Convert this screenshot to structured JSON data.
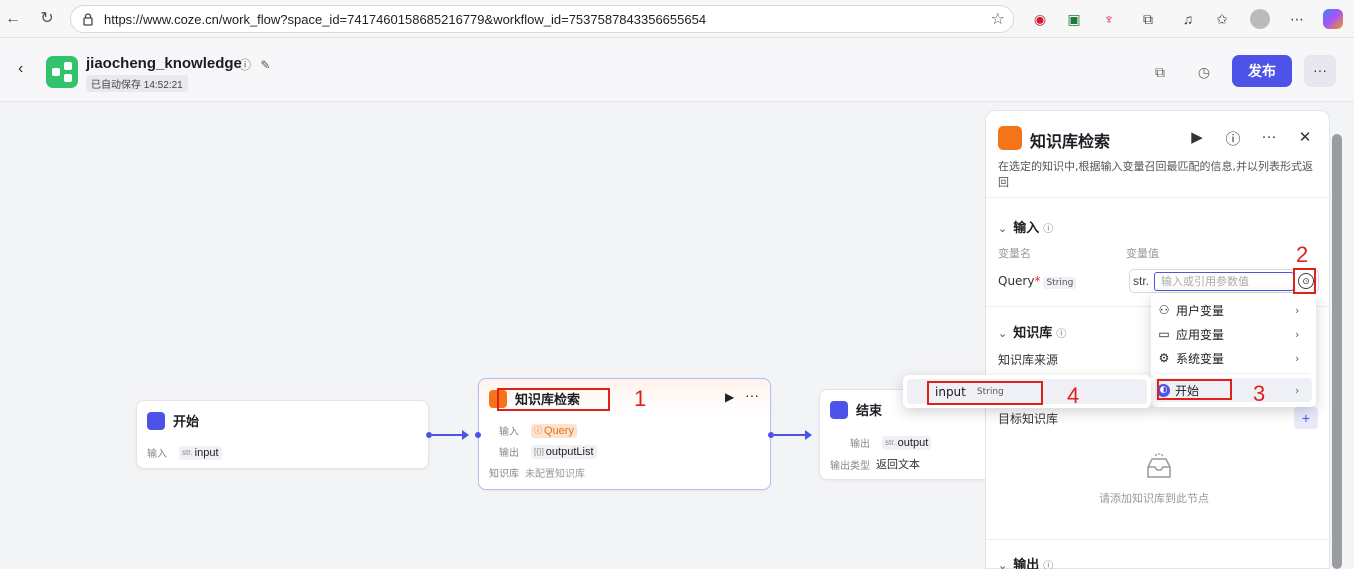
{
  "browser": {
    "url": "https://www.coze.cn/work_flow?space_id=7417460158685216779&workflow_id=7537587843356655654"
  },
  "header": {
    "title": "jiaocheng_knowledge",
    "saved_status": "已自动保存 14:52:21",
    "publish_label": "发布",
    "more_label": "···"
  },
  "nodes": {
    "start": {
      "title": "开始",
      "rows": [
        {
          "label": "输入",
          "type": "str.",
          "value": "input"
        }
      ]
    },
    "knowledge": {
      "title": "知识库检索",
      "input_label": "输入",
      "input_value": "Query",
      "output_label": "输出",
      "output_type": "[{}]",
      "output_value": "outputList",
      "kb_label": "知识库",
      "kb_value": "未配置知识库"
    },
    "end": {
      "title": "结束",
      "output_label": "输出",
      "output_type": "str.",
      "output_value": "output",
      "output_type_label": "输出类型",
      "output_type_value": "返回文本"
    }
  },
  "panel": {
    "title": "知识库检索",
    "description": "在选定的知识中,根据输入变量召回最匹配的信息,并以列表形式返回",
    "input_section": "输入",
    "col_name": "变量名",
    "col_value": "变量值",
    "field_name": "Query",
    "field_required": "*",
    "field_type": "String",
    "str_prefix": "str.",
    "field_placeholder": "输入或引用参数值",
    "kb_section": "知识库",
    "kb_source_label": "知识库来源",
    "target_kb_label": "目标知识库",
    "empty_hint": "请添加知识库到此节点",
    "output_section": "输出"
  },
  "var_menu": {
    "items": [
      {
        "icon": "user-icon",
        "label": "用户变量"
      },
      {
        "icon": "folder-icon",
        "label": "应用变量"
      },
      {
        "icon": "gear-icon",
        "label": "系统变量"
      },
      {
        "icon": "start-icon",
        "label": "开始"
      }
    ]
  },
  "sub_menu": {
    "name": "input",
    "type": "String"
  },
  "annotations": [
    "1",
    "2",
    "3",
    "4"
  ],
  "colors": {
    "accent": "#4d53e8",
    "start_node": "#4d53e8",
    "knowledge_node": "#f5741a",
    "annotation_red": "#e0201b"
  }
}
